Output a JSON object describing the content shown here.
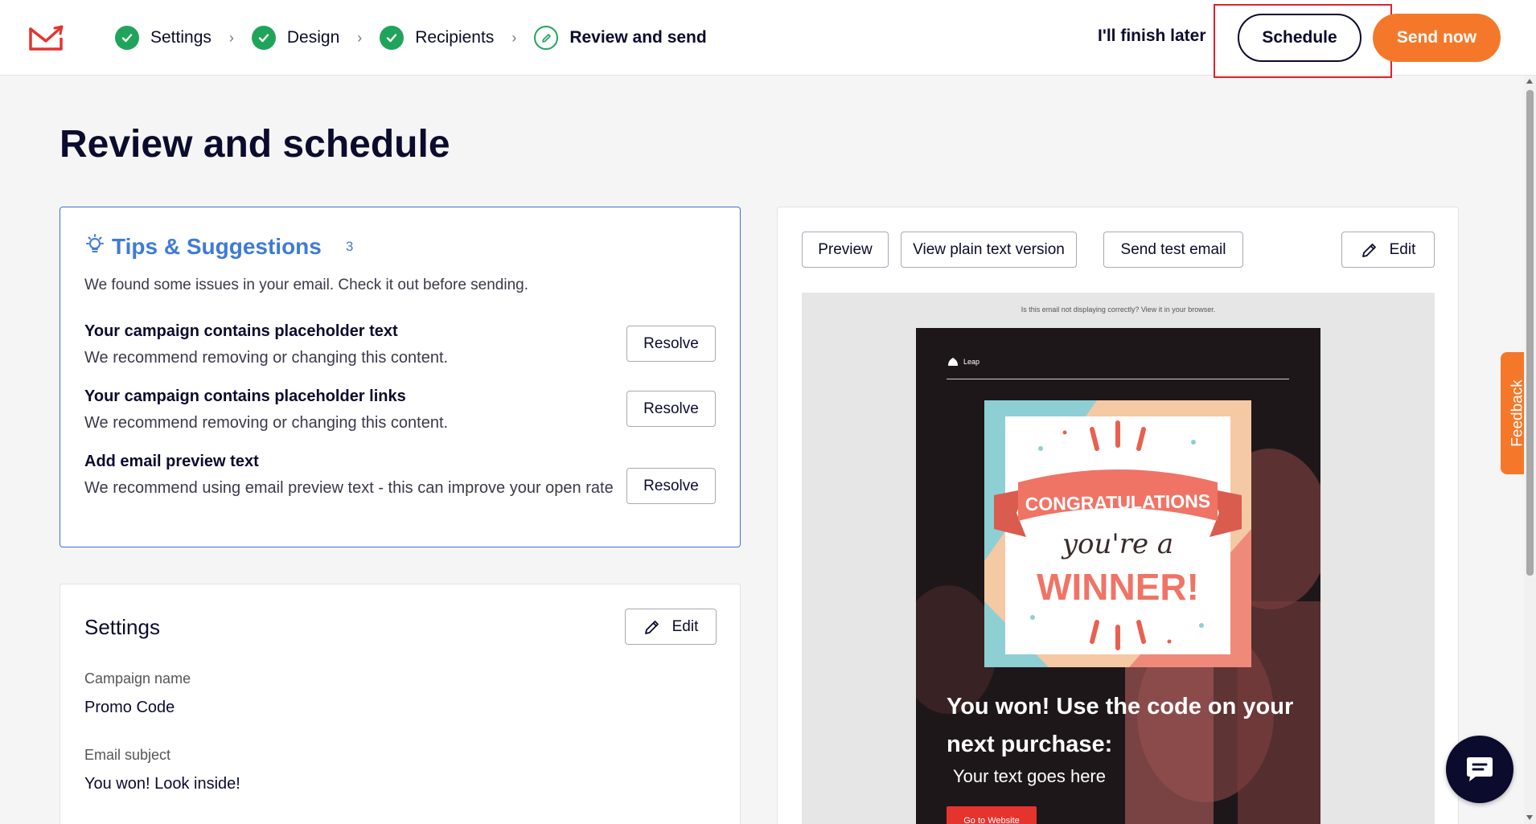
{
  "header": {
    "steps": [
      {
        "label": "Settings",
        "state": "done"
      },
      {
        "label": "Design",
        "state": "done"
      },
      {
        "label": "Recipients",
        "state": "done"
      },
      {
        "label": "Review and send",
        "state": "current"
      }
    ],
    "finish_later": "I'll finish later",
    "schedule_label": "Schedule",
    "send_now_label": "Send now"
  },
  "page": {
    "title": "Review and schedule"
  },
  "tips": {
    "title": "Tips & Suggestions",
    "count": "3",
    "intro": "We found some issues in your email. Check it out before sending.",
    "issues": [
      {
        "title": "Your campaign contains placeholder text",
        "desc": "We recommend removing or changing this content.",
        "action": "Resolve"
      },
      {
        "title": "Your campaign contains placeholder links",
        "desc": "We recommend removing or changing this content.",
        "action": "Resolve"
      },
      {
        "title": "Add email preview text",
        "desc": "We recommend using email preview text - this can improve your open rate",
        "action": "Resolve"
      }
    ]
  },
  "settings": {
    "title": "Settings",
    "edit_label": "Edit",
    "campaign_name_label": "Campaign name",
    "campaign_name": "Promo Code",
    "subject_label": "Email subject",
    "subject": "You won! Look inside!"
  },
  "preview": {
    "preview_label": "Preview",
    "plain_text_label": "View plain text version",
    "test_email_label": "Send test email",
    "edit_label": "Edit",
    "email": {
      "browser_note": "Is this email not displaying correctly? View it in your browser.",
      "brand": "Leap",
      "image_text_top": "CONGRATULATIONS",
      "image_text_mid": "you're a",
      "image_text_bottom": "WINNER!",
      "headline": "You won! Use the code on your next purchase:",
      "subtext": "Your text goes here",
      "cta": "Go to Website"
    }
  },
  "feedback_label": "Feedback",
  "colors": {
    "accent_orange": "#f5782a",
    "navy": "#0b0b2e",
    "success_green": "#20a45c",
    "link_blue": "#3e7bd6",
    "highlight_red": "#e3202d"
  }
}
